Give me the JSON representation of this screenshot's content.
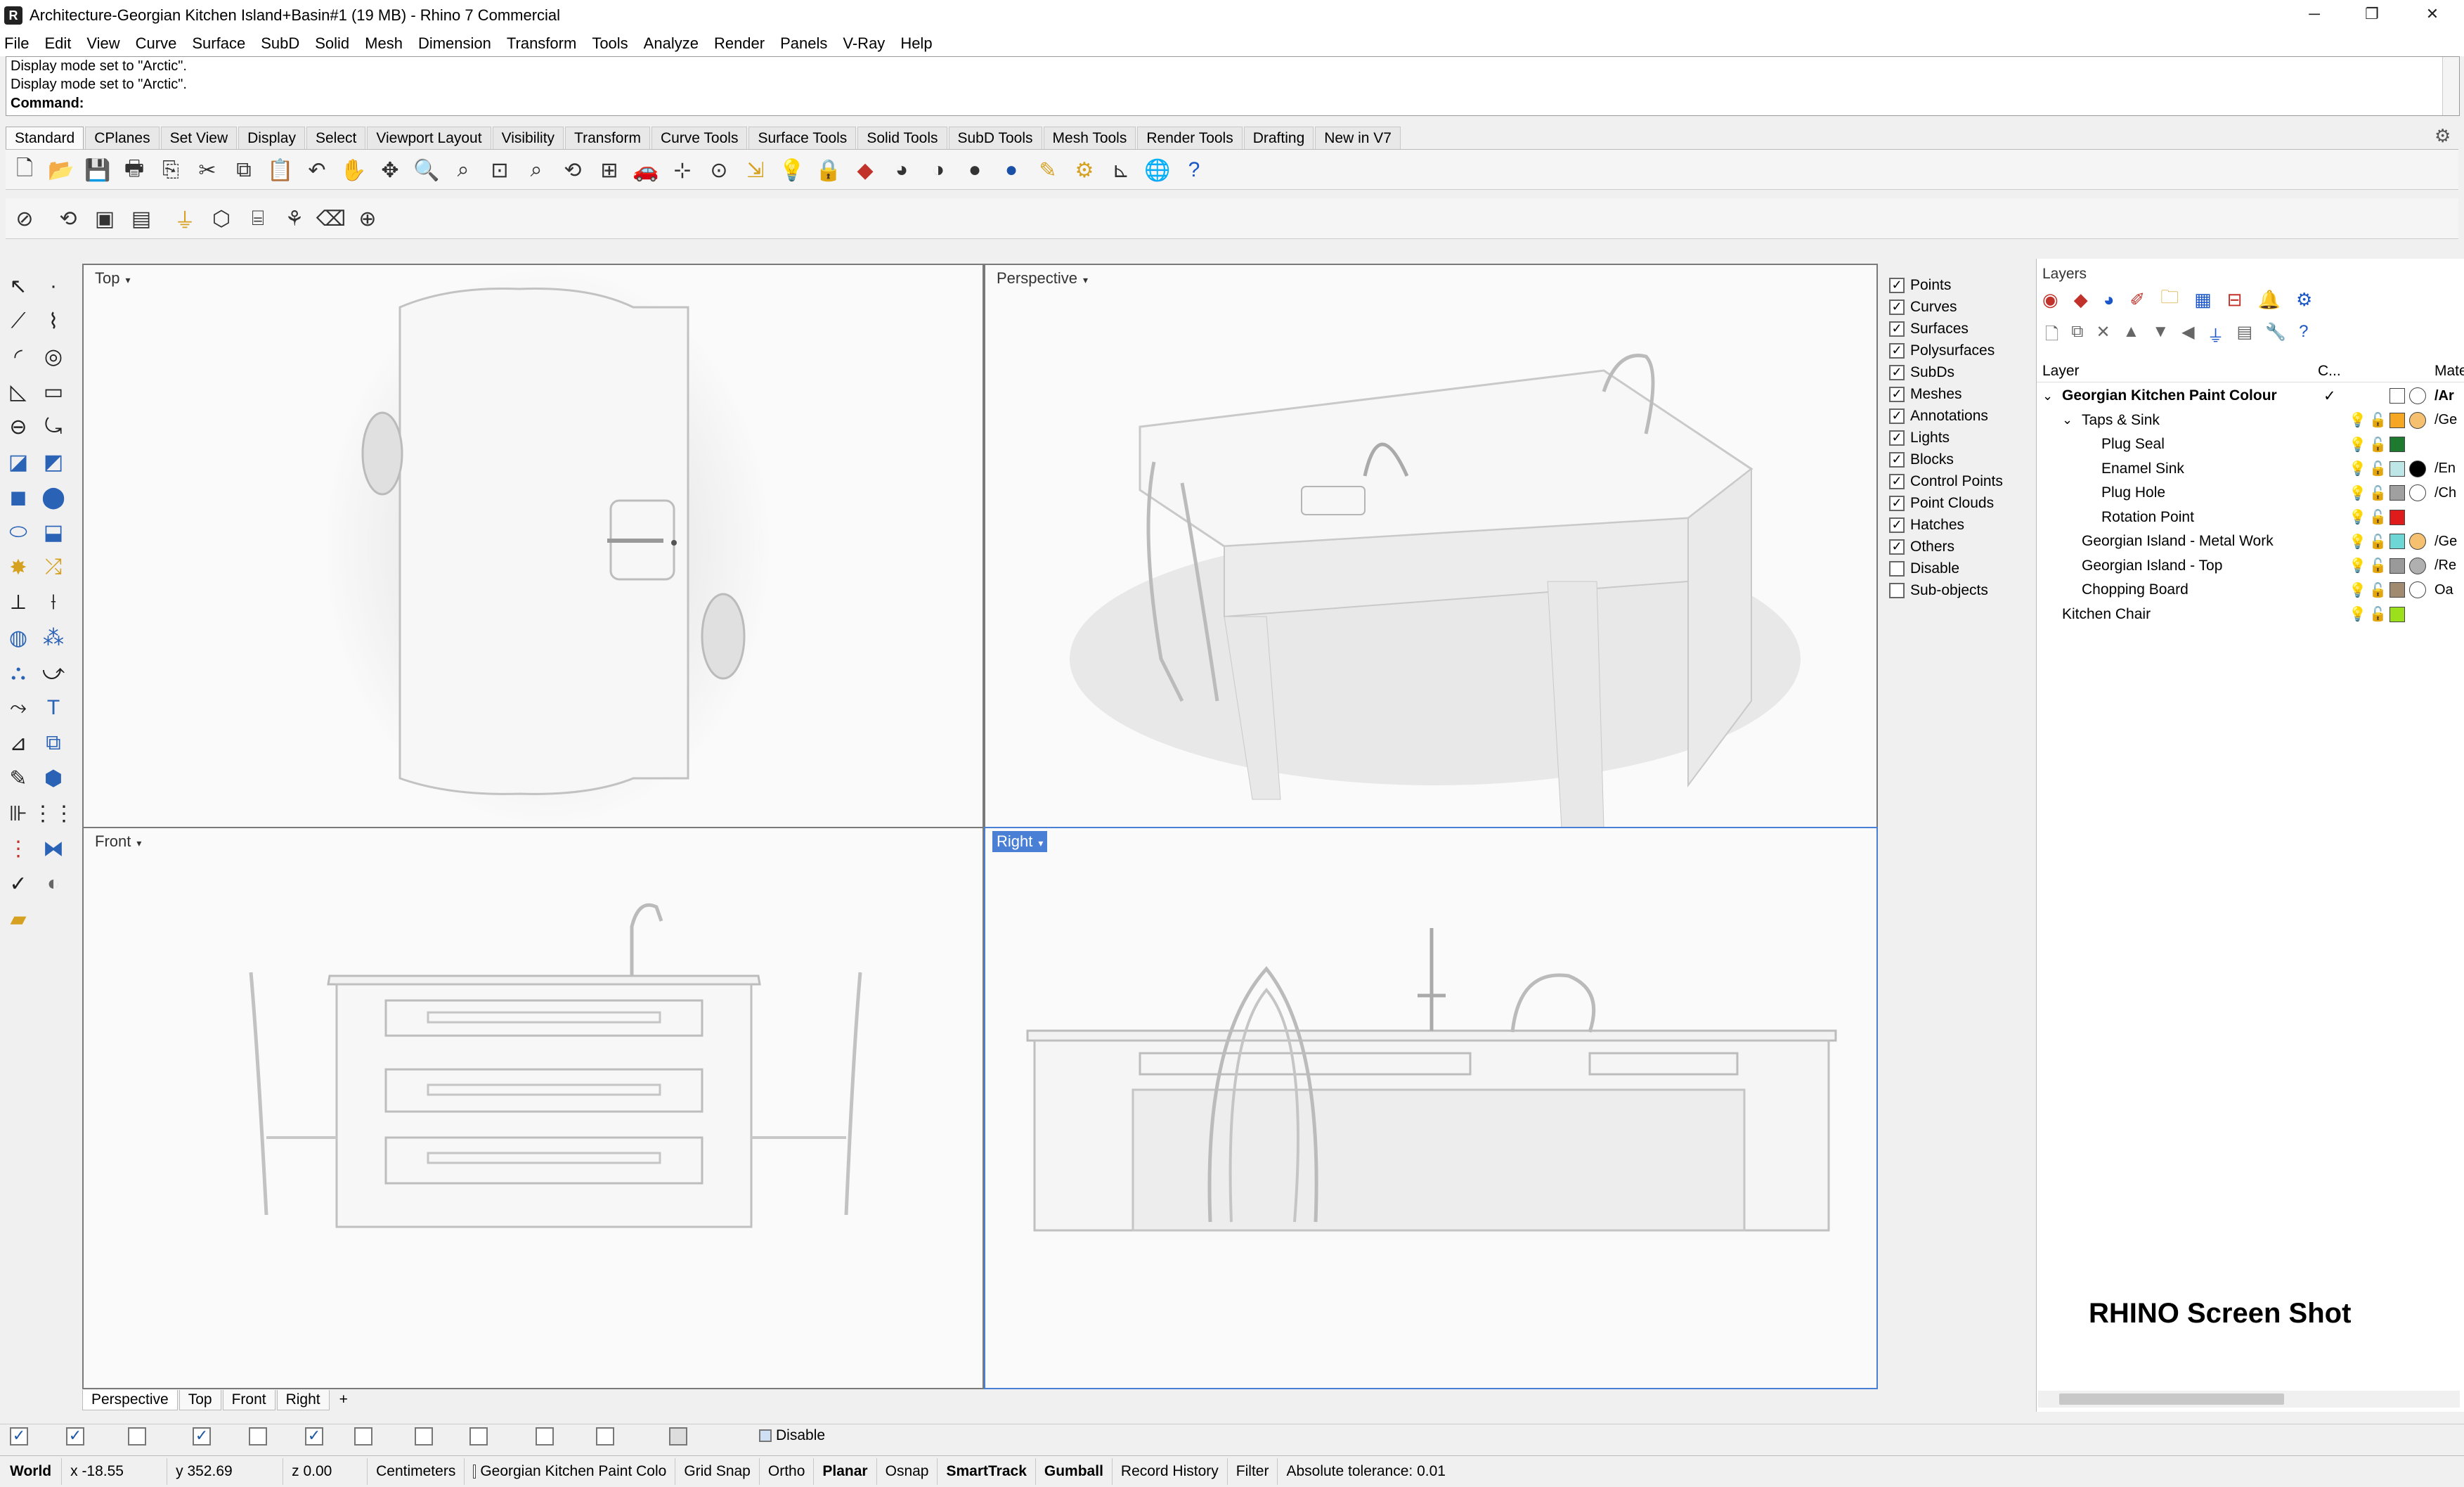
{
  "window": {
    "title": "Architecture-Georgian Kitchen Island+Basin#1 (19 MB) - Rhino 7 Commercial",
    "minimize": "─",
    "restore": "❐",
    "close": "✕"
  },
  "menu": [
    "File",
    "Edit",
    "View",
    "Curve",
    "Surface",
    "SubD",
    "Solid",
    "Mesh",
    "Dimension",
    "Transform",
    "Tools",
    "Analyze",
    "Render",
    "Panels",
    "V-Ray",
    "Help"
  ],
  "command": {
    "history": [
      "Display mode set to \"Arctic\".",
      "Display mode set to \"Arctic\"."
    ],
    "prompt": "Command:"
  },
  "toolbar_tabs": [
    "Standard",
    "CPlanes",
    "Set View",
    "Display",
    "Select",
    "Viewport Layout",
    "Visibility",
    "Transform",
    "Curve Tools",
    "Surface Tools",
    "Solid Tools",
    "SubD Tools",
    "Mesh Tools",
    "Render Tools",
    "Drafting",
    "New in V7"
  ],
  "viewports": {
    "top": {
      "title": "Top"
    },
    "perspective": {
      "title": "Perspective"
    },
    "front": {
      "title": "Front"
    },
    "right": {
      "title": "Right"
    }
  },
  "viewport_tabs": [
    "Perspective",
    "Top",
    "Front",
    "Right",
    "+"
  ],
  "display_filter": {
    "items": [
      {
        "label": "Points",
        "checked": true
      },
      {
        "label": "Curves",
        "checked": true
      },
      {
        "label": "Surfaces",
        "checked": true
      },
      {
        "label": "Polysurfaces",
        "checked": true
      },
      {
        "label": "SubDs",
        "checked": true
      },
      {
        "label": "Meshes",
        "checked": true
      },
      {
        "label": "Annotations",
        "checked": true
      },
      {
        "label": "Lights",
        "checked": true
      },
      {
        "label": "Blocks",
        "checked": true
      },
      {
        "label": "Control Points",
        "checked": true
      },
      {
        "label": "Point Clouds",
        "checked": true
      },
      {
        "label": "Hatches",
        "checked": true
      },
      {
        "label": "Others",
        "checked": true
      },
      {
        "label": "Disable",
        "checked": false
      },
      {
        "label": "Sub-objects",
        "checked": false
      }
    ]
  },
  "layers": {
    "title": "Layers",
    "col_layer": "Layer",
    "col_current": "C...",
    "col_material": "Materi",
    "rows": [
      {
        "name": "Georgian Kitchen Paint Colour",
        "current": "✓",
        "color": "#ffffff",
        "mat_color": "#ffffff",
        "mat": "/Ar",
        "bold": true,
        "level": 0,
        "expand": "⌄"
      },
      {
        "name": "Taps & Sink",
        "current": "",
        "color": "#f5a623",
        "mat_color": "#f5c070",
        "mat": "/Ge",
        "bold": false,
        "level": 1,
        "expand": "⌄"
      },
      {
        "name": "Plug Seal",
        "current": "",
        "color": "#1e7a2e",
        "mat_color": "",
        "mat": "",
        "bold": false,
        "level": 2,
        "expand": ""
      },
      {
        "name": "Enamel Sink",
        "current": "",
        "color": "#bfe6e6",
        "mat_color": "#000000",
        "mat": "/En",
        "bold": false,
        "level": 2,
        "expand": ""
      },
      {
        "name": "Plug Hole",
        "current": "",
        "color": "#a0a0a0",
        "mat_color": "#ffffff",
        "mat": "/Ch",
        "bold": false,
        "level": 2,
        "expand": ""
      },
      {
        "name": "Rotation Point",
        "current": "",
        "color": "#e01b1b",
        "mat_color": "",
        "mat": "",
        "bold": false,
        "level": 2,
        "expand": ""
      },
      {
        "name": "Georgian Island - Metal Work",
        "current": "",
        "color": "#6fd6d6",
        "mat_color": "#f5c070",
        "mat": "/Ge",
        "bold": false,
        "level": 1,
        "expand": ""
      },
      {
        "name": "Georgian Island - Top",
        "current": "",
        "color": "#9a9a9a",
        "mat_color": "#b0b0b0",
        "mat": "/Re",
        "bold": false,
        "level": 1,
        "expand": ""
      },
      {
        "name": "Chopping Board",
        "current": "",
        "color": "#a08a70",
        "mat_color": "#ffffff",
        "mat": "Oa",
        "bold": false,
        "level": 1,
        "expand": ""
      },
      {
        "name": "Kitchen Chair",
        "current": "",
        "color": "#9be01b",
        "mat_color": "",
        "mat": "",
        "bold": false,
        "level": 0,
        "expand": ""
      }
    ]
  },
  "watermark": "RHINO Screen Shot",
  "osnap_disable": "Disable",
  "status": {
    "cplane": "World",
    "x": "x -18.55",
    "y": "y 352.69",
    "z": "z 0.00",
    "units": "Centimeters",
    "layer": "Georgian Kitchen Paint Colo",
    "grid_snap": "Grid Snap",
    "ortho": "Ortho",
    "planar": "Planar",
    "osnap": "Osnap",
    "smarttrack": "SmartTrack",
    "gumball": "Gumball",
    "record_history": "Record History",
    "filter": "Filter",
    "tolerance": "Absolute tolerance: 0.01"
  }
}
